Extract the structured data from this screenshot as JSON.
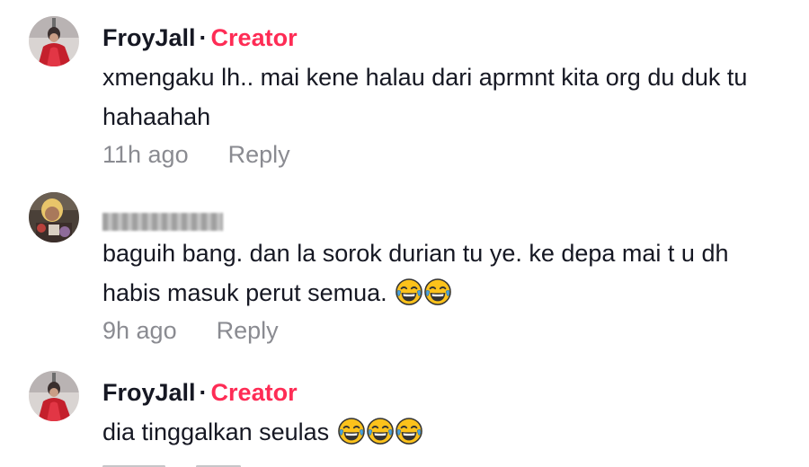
{
  "comments": [
    {
      "username": "FroyJall",
      "separator": "·",
      "badge": "Creator",
      "text": "xmengaku lh.. mai kene halau dari aprmnt kita org du duk tu hahaahah",
      "time": "11h ago",
      "reply_label": "Reply",
      "avatar": "profile-photo-red"
    },
    {
      "username_redacted": true,
      "text": "baguih bang. dan la sorok durian tu ye. ke depa mai t u dh habis masuk perut semua.",
      "emojis": [
        "face-with-tears-of-joy",
        "face-with-tears-of-joy"
      ],
      "time": "9h ago",
      "reply_label": "Reply",
      "avatar": "profile-photo-dark"
    },
    {
      "username": "FroyJall",
      "separator": "·",
      "badge": "Creator",
      "text": "dia tinggalkan seulas",
      "emojis": [
        "face-with-tears-of-joy",
        "face-with-tears-of-joy",
        "face-with-tears-of-joy"
      ],
      "avatar": "profile-photo-red"
    }
  ],
  "colors": {
    "creator_badge": "#fe2c55",
    "meta_text": "#8a8b91",
    "body_text": "#161823"
  }
}
